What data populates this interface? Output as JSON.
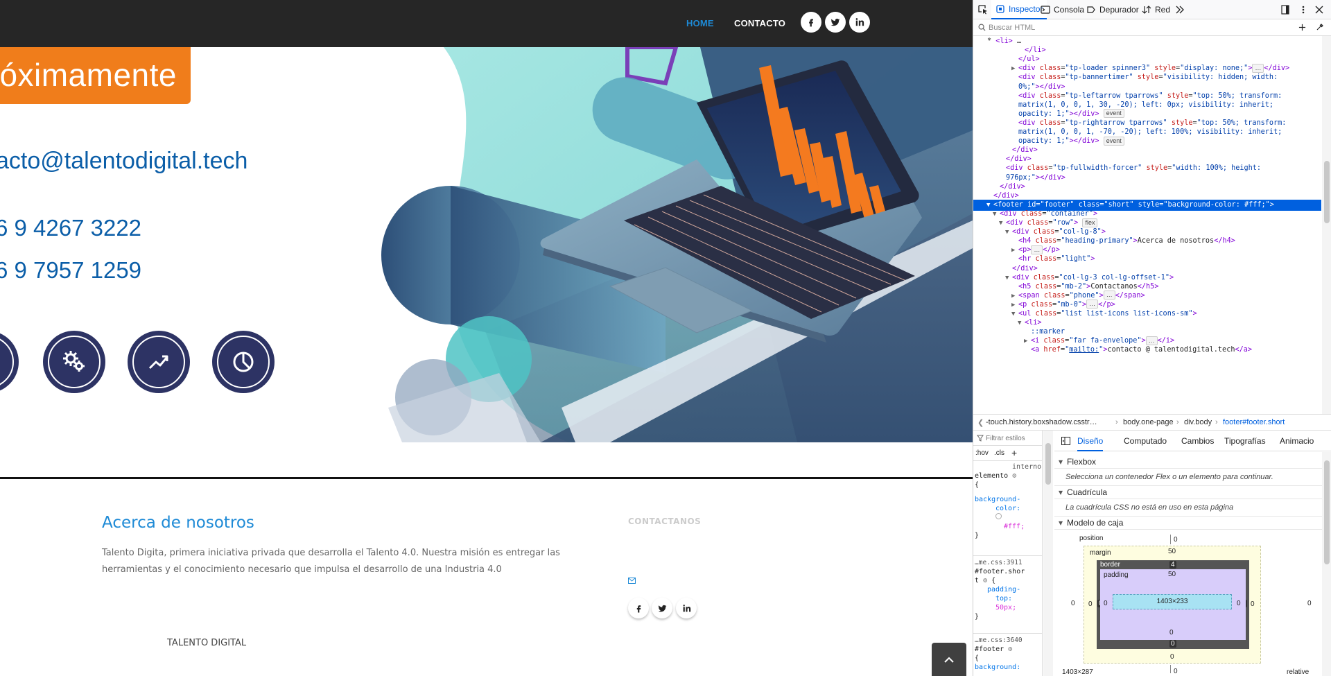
{
  "site": {
    "nav": {
      "home": "HOME",
      "contact": "CONTACTO"
    },
    "hero": {
      "badge": "óximamente",
      "email": "acto@talentodigital.tech",
      "phone1": "6 9 4267 3222",
      "phone2": "6 9 7957 1259"
    },
    "footer": {
      "about_title": "Acerca de nosotros",
      "about_text": "Talento Digita, primera iniciativa privada que desarrolla el Talento 4.0. Nuestra misión es entregar las herramientas y el conocimiento necesario que impulsa el desarrollo de una Industria 4.0",
      "contact_title": "CONTACTANOS",
      "brand": "TALENTO DIGITAL"
    },
    "colors": {
      "nav_active": "#1e8ad6",
      "badge": "#f07d1b",
      "hero_text": "#0b5ea8",
      "icon_circle": "#2d3364"
    }
  },
  "devtools": {
    "tabs": {
      "inspector": "Inspector",
      "console": "Consola",
      "debugger": "Depurador",
      "network": "Red"
    },
    "search_placeholder": "Buscar HTML",
    "tree": [
      {
        "i": 0,
        "html": "<span class='x'>* </span><span class='t'>&lt;li&gt;</span><span class='x'> … </span>"
      },
      {
        "i": 6,
        "html": "<span class='t'>&lt;/li&gt;</span>"
      },
      {
        "i": 5,
        "html": "<span class='t'>&lt;/ul&gt;</span>"
      },
      {
        "i": 5,
        "tw": "▶",
        "html": "<span class='t'>&lt;div </span><span class='a'>class</span>=<span class='v'>\"tp-loader spinner3\"</span> <span class='a'>style</span>=<span class='v'>\"display: none;\"</span><span class='t'>&gt;</span><span class='pill'>…</span><span class='t'>&lt;/div&gt;</span>"
      },
      {
        "i": 5,
        "html": "<span class='t'>&lt;div </span><span class='a'>class</span>=<span class='v'>\"tp-bannertimer\"</span> <span class='a'>style</span>=<span class='v'>\"visibility: hidden; width:</span>"
      },
      {
        "i": 5,
        "html": "<span class='v'>0%;\"</span><span class='t'>&gt;&lt;/div&gt;</span>"
      },
      {
        "i": 5,
        "html": "<span class='t'>&lt;div </span><span class='a'>class</span>=<span class='v'>\"tp-leftarrow tparrows\"</span> <span class='a'>style</span>=<span class='v'>\"top: 50%; transform:</span>"
      },
      {
        "i": 5,
        "html": "<span class='v'>matrix(1, 0, 0, 1, 30, -20); left: 0px; visibility: inherit;</span>"
      },
      {
        "i": 5,
        "html": "<span class='v'>opacity: 1;\"</span><span class='t'>&gt;&lt;/div&gt;</span> <span class='pill'>event</span>"
      },
      {
        "i": 5,
        "html": "<span class='t'>&lt;div </span><span class='a'>class</span>=<span class='v'>\"tp-rightarrow tparrows\"</span> <span class='a'>style</span>=<span class='v'>\"top: 50%; transform:</span>"
      },
      {
        "i": 5,
        "html": "<span class='v'>matrix(1, 0, 0, 1, -70, -20); left: 100%; visibility: inherit;</span>"
      },
      {
        "i": 5,
        "html": "<span class='v'>opacity: 1;\"</span><span class='t'>&gt;&lt;/div&gt;</span> <span class='pill'>event</span>"
      },
      {
        "i": 4,
        "html": "<span class='t'>&lt;/div&gt;</span>"
      },
      {
        "i": 3,
        "html": "<span class='t'>&lt;/div&gt;</span>"
      },
      {
        "i": 3,
        "html": "<span class='t'>&lt;div </span><span class='a'>class</span>=<span class='v'>\"tp-fullwidth-forcer\"</span> <span class='a'>style</span>=<span class='v'>\"width: 100%; height:</span>"
      },
      {
        "i": 3,
        "html": "<span class='v'>976px;\"</span><span class='t'>&gt;&lt;/div&gt;</span>"
      },
      {
        "i": 2,
        "html": "<span class='t'>&lt;/div&gt;</span>"
      },
      {
        "i": 1,
        "html": "<span class='t'>&lt;/div&gt;</span>"
      },
      {
        "i": 1,
        "tw": "▼",
        "sel": true,
        "html": "<span class='t'>&lt;footer </span><span class='a'>id</span>=<span class='v'>\"footer\"</span> <span class='a'>class</span>=<span class='v'>\"short\"</span> <span class='a'>style</span>=<span class='v'>\"background-color: #fff;\"</span><span class='t'>&gt;</span>"
      },
      {
        "i": 2,
        "tw": "▼",
        "html": "<span class='t'>&lt;div </span><span class='a'>class</span>=<span class='v'>\"container\"</span><span class='t'>&gt;</span>"
      },
      {
        "i": 3,
        "tw": "▼",
        "html": "<span class='t'>&lt;div </span><span class='a'>class</span>=<span class='v'>\"row\"</span><span class='t'>&gt;</span> <span class='pill'>flex</span>"
      },
      {
        "i": 4,
        "tw": "▼",
        "html": "<span class='t'>&lt;div </span><span class='a'>class</span>=<span class='v'>\"col-lg-8\"</span><span class='t'>&gt;</span>"
      },
      {
        "i": 5,
        "html": "<span class='t'>&lt;h4 </span><span class='a'>class</span>=<span class='v'>\"heading-primary\"</span><span class='t'>&gt;</span><span class='x'>Acerca de nosotros</span><span class='t'>&lt;/h4&gt;</span>"
      },
      {
        "i": 5,
        "tw": "▶",
        "html": "<span class='t'>&lt;p&gt;</span><span class='pill'>…</span><span class='t'>&lt;/p&gt;</span>"
      },
      {
        "i": 5,
        "html": "<span class='t'>&lt;hr </span><span class='a'>class</span>=<span class='v'>\"light\"</span><span class='t'>&gt;</span>"
      },
      {
        "i": 4,
        "html": "<span class='t'>&lt;/div&gt;</span>"
      },
      {
        "i": 4,
        "tw": "▼",
        "html": "<span class='t'>&lt;div </span><span class='a'>class</span>=<span class='v'>\"col-lg-3 col-lg-offset-1\"</span><span class='t'>&gt;</span>"
      },
      {
        "i": 5,
        "html": "<span class='t'>&lt;h5 </span><span class='a'>class</span>=<span class='v'>\"mb-2\"</span><span class='t'>&gt;</span><span class='x'>Contactanos</span><span class='t'>&lt;/h5&gt;</span>"
      },
      {
        "i": 5,
        "tw": "▶",
        "html": "<span class='t'>&lt;span </span><span class='a'>class</span>=<span class='v'>\"phone\"</span><span class='t'>&gt;</span><span class='pill'>…</span><span class='t'>&lt;/span&gt;</span>"
      },
      {
        "i": 5,
        "tw": "▶",
        "html": "<span class='t'>&lt;p </span><span class='a'>class</span>=<span class='v'>\"mb-0\"</span><span class='t'>&gt;</span><span class='pill'>…</span><span class='t'>&lt;/p&gt;</span>"
      },
      {
        "i": 5,
        "tw": "▼",
        "html": "<span class='t'>&lt;ul </span><span class='a'>class</span>=<span class='v'>\"list list-icons list-icons-sm\"</span><span class='t'>&gt;</span>"
      },
      {
        "i": 6,
        "tw": "▼",
        "html": "<span class='t'>&lt;li&gt;</span>"
      },
      {
        "i": 7,
        "html": "<span class='v'>::marker</span>"
      },
      {
        "i": 7,
        "tw": "▶",
        "html": "<span class='t'>&lt;i </span><span class='a'>class</span>=<span class='v'>\"far fa-envelope\"</span><span class='t'>&gt;</span><span class='pill'>…</span><span class='t'>&lt;/i&gt;</span>"
      },
      {
        "i": 7,
        "html": "<span class='t'>&lt;a </span><span class='a'>href</span>=<span class='v'>\"<u>mailto:</u>\"</span><span class='t'>&gt;</span><span class='x'>contacto @ talentodigital.tech</span><span class='t'>&lt;/a&gt;</span>"
      }
    ],
    "breadcrumb": {
      "b1": "-touch.history.boxshadow.csstr…",
      "b2": "body.one-page",
      "b3": "div.body",
      "b4": "footer#footer.short"
    },
    "rules": {
      "filter_placeholder": "Filtrar estilos",
      "hov": ":hov",
      "cls": ".cls",
      "l1": "interno",
      "l2": "elemento",
      "l3": "{",
      "l4": "background-",
      "l5": "color:",
      "l6": "#fff;",
      "l7": "}",
      "src1": "…me.css:3911",
      "sel1": "#footer.shor",
      "sel1b": "t",
      "l8": "{",
      "l9": "padding-",
      "l10": "top:",
      "l11": "50px;",
      "l12": "}",
      "src2": "…me.css:3640",
      "sel2": "#footer",
      "l13": "{",
      "l14": "background:"
    },
    "layout": {
      "tabs": {
        "design": "Diseño",
        "computed": "Computado",
        "changes": "Cambios",
        "typography": "Tipografías",
        "animations": "Animacio"
      },
      "flexbox_title": "Flexbox",
      "flexbox_msg": "Selecciona un contenedor Flex o un elemento para continuar.",
      "grid_title": "Cuadrícula",
      "grid_msg": "La cuadrícula CSS no está en uso en esta página",
      "boxmodel_title": "Modelo de caja",
      "box": {
        "position_label": "position",
        "position_top": "0",
        "position_bottom": "0",
        "position_left": "0",
        "position_right": "0",
        "margin_label": "margin",
        "margin_top": "50",
        "margin_bottom": "0",
        "margin_left": "0",
        "margin_right": "0",
        "border_label": "border",
        "border_top": "4",
        "border_bottom": "0",
        "border_left": "0",
        "border_right": "0",
        "padding_label": "padding",
        "padding_top": "50",
        "padding_bottom": "0",
        "padding_left": "0",
        "padding_right": "0",
        "content": "1403×233"
      },
      "footer_size": "1403×287",
      "footer_position": "relative"
    }
  }
}
